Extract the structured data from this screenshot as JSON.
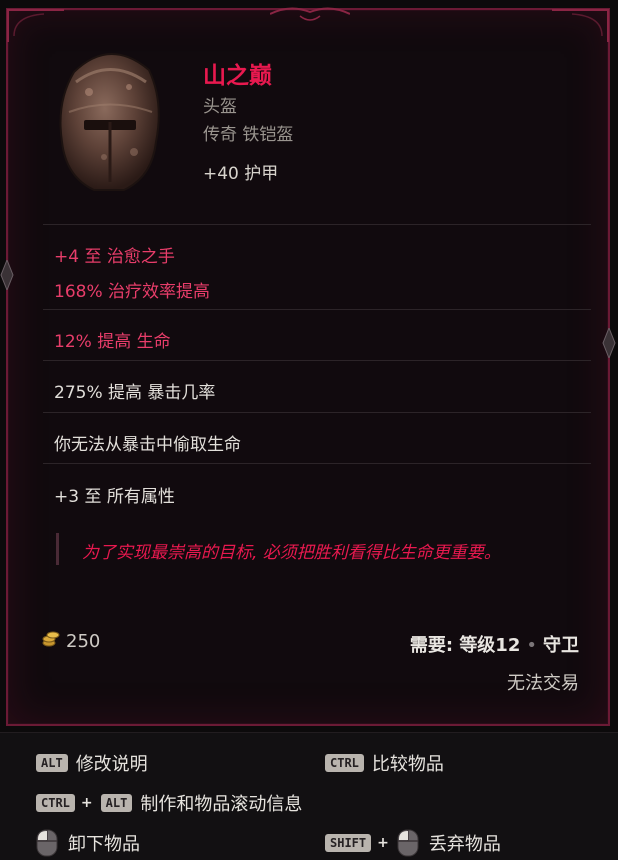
{
  "item": {
    "name": "山之巅",
    "type": "头盔",
    "rarity_base": "传奇 铁铠盔",
    "implicit": "+40 护甲"
  },
  "mods": [
    {
      "text": "+4 至 治愈之手",
      "color": "red"
    },
    {
      "text": "168% 治疗效率提高",
      "color": "red"
    },
    {
      "text": "12% 提高 生命",
      "color": "red"
    },
    {
      "text": "275% 提高 暴击几率",
      "color": "white"
    },
    {
      "text": "你无法从暴击中偷取生命",
      "color": "white"
    },
    {
      "text": "+3 至 所有属性",
      "color": "white"
    }
  ],
  "lore": "为了实现最崇高的目标, 必须把胜利看得比生命更重要。",
  "gold": "250",
  "requirement": {
    "label": "需要:",
    "level": "等级12",
    "class": "守卫"
  },
  "untradable": "无法交易",
  "controls": {
    "alt_key": "ALT",
    "alt_label": "修改说明",
    "ctrl_key": "CTRL",
    "ctrl_label": "比较物品",
    "craft_key1": "CTRL",
    "craft_plus": "+",
    "craft_key2": "ALT",
    "craft_label": "制作和物品滚动信息",
    "unequip_label": "卸下物品",
    "shift_key": "SHIFT",
    "shift_plus": "+",
    "drop_label": "丢弃物品"
  },
  "colors": {
    "legendary": "#e8194f",
    "affix_red": "#e83d6a",
    "border": "#6b1a35"
  }
}
